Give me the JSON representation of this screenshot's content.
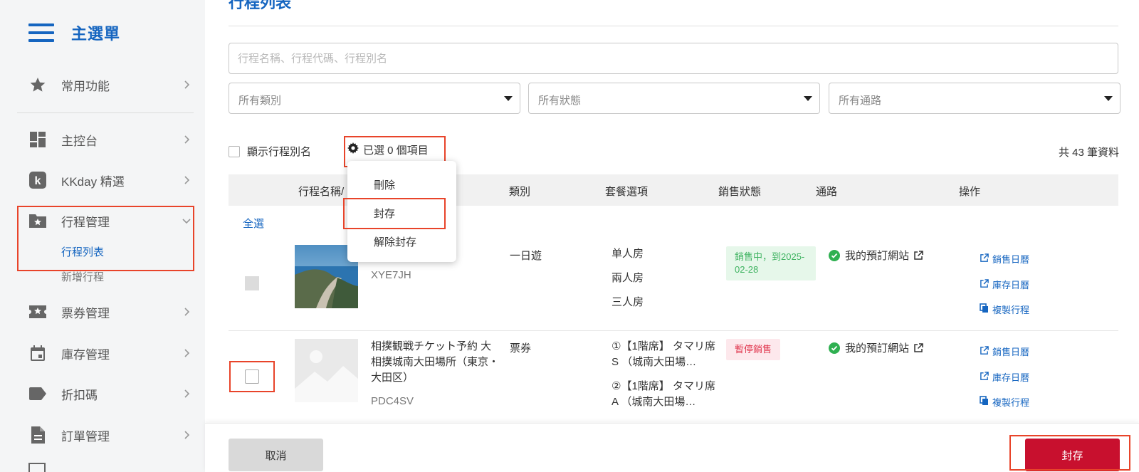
{
  "sidebar": {
    "title": "主選單",
    "items": [
      {
        "label": "常用功能",
        "icon": "star-icon"
      },
      {
        "label": "主控台",
        "icon": "dashboard-icon"
      },
      {
        "label": "KKday 精選",
        "icon": "kkday-icon"
      },
      {
        "label": "行程管理",
        "icon": "folder-star-icon"
      },
      {
        "label": "票券管理",
        "icon": "ticket-icon"
      },
      {
        "label": "庫存管理",
        "icon": "calendar-icon"
      },
      {
        "label": "折扣碼",
        "icon": "tag-icon"
      },
      {
        "label": "訂單管理",
        "icon": "document-icon"
      }
    ],
    "subitems": {
      "active": "行程列表",
      "next": "新增行程"
    }
  },
  "page": {
    "title": "行程列表"
  },
  "search": {
    "placeholder": "行程名稱、行程代碼、行程別名"
  },
  "filters": {
    "category": "所有類別",
    "status": "所有狀態",
    "channel": "所有通路"
  },
  "toolbar": {
    "show_alias_label": "顯示行程別名",
    "selected_label": "已選 0 個項目",
    "total_label": "共 43 筆資料"
  },
  "menu": {
    "delete": "刪除",
    "archive": "封存",
    "unarchive": "解除封存"
  },
  "table": {
    "headers": {
      "name": "行程名稱/",
      "category": "類別",
      "package": "套餐選項",
      "sales_status": "銷售狀態",
      "channel": "通路",
      "actions": "操作"
    },
    "select_all": "全選",
    "rows": [
      {
        "name": "",
        "code": "XYE7JH",
        "category": "一日遊",
        "packages": [
          "单人房",
          "兩人房",
          "三人房"
        ],
        "status": "銷售中，到2025-02-28",
        "channel": "我的預訂網站"
      },
      {
        "name": "相撲観戦チケット予約 大相撲城南大田場所（東京・大田区）",
        "code": "PDC4SV",
        "category": "票券",
        "packages": [
          "①【1階席】 タマリ席S （城南大田場…",
          "②【1階席】 タマリ席A （城南大田場…"
        ],
        "status": "暫停銷售",
        "channel": "我的預訂網站"
      }
    ],
    "actions": {
      "sales_calendar": "銷售日曆",
      "inventory_calendar": "庫存日曆",
      "copy_tour": "複製行程"
    }
  },
  "footer": {
    "cancel_label": "取消",
    "archive_label": "封存"
  },
  "colors": {
    "brand_blue": "#1565c0",
    "archive_red": "#c8102e",
    "highlight": "#e8442a",
    "status_on": "#3fb361",
    "status_off": "#e0334b"
  }
}
